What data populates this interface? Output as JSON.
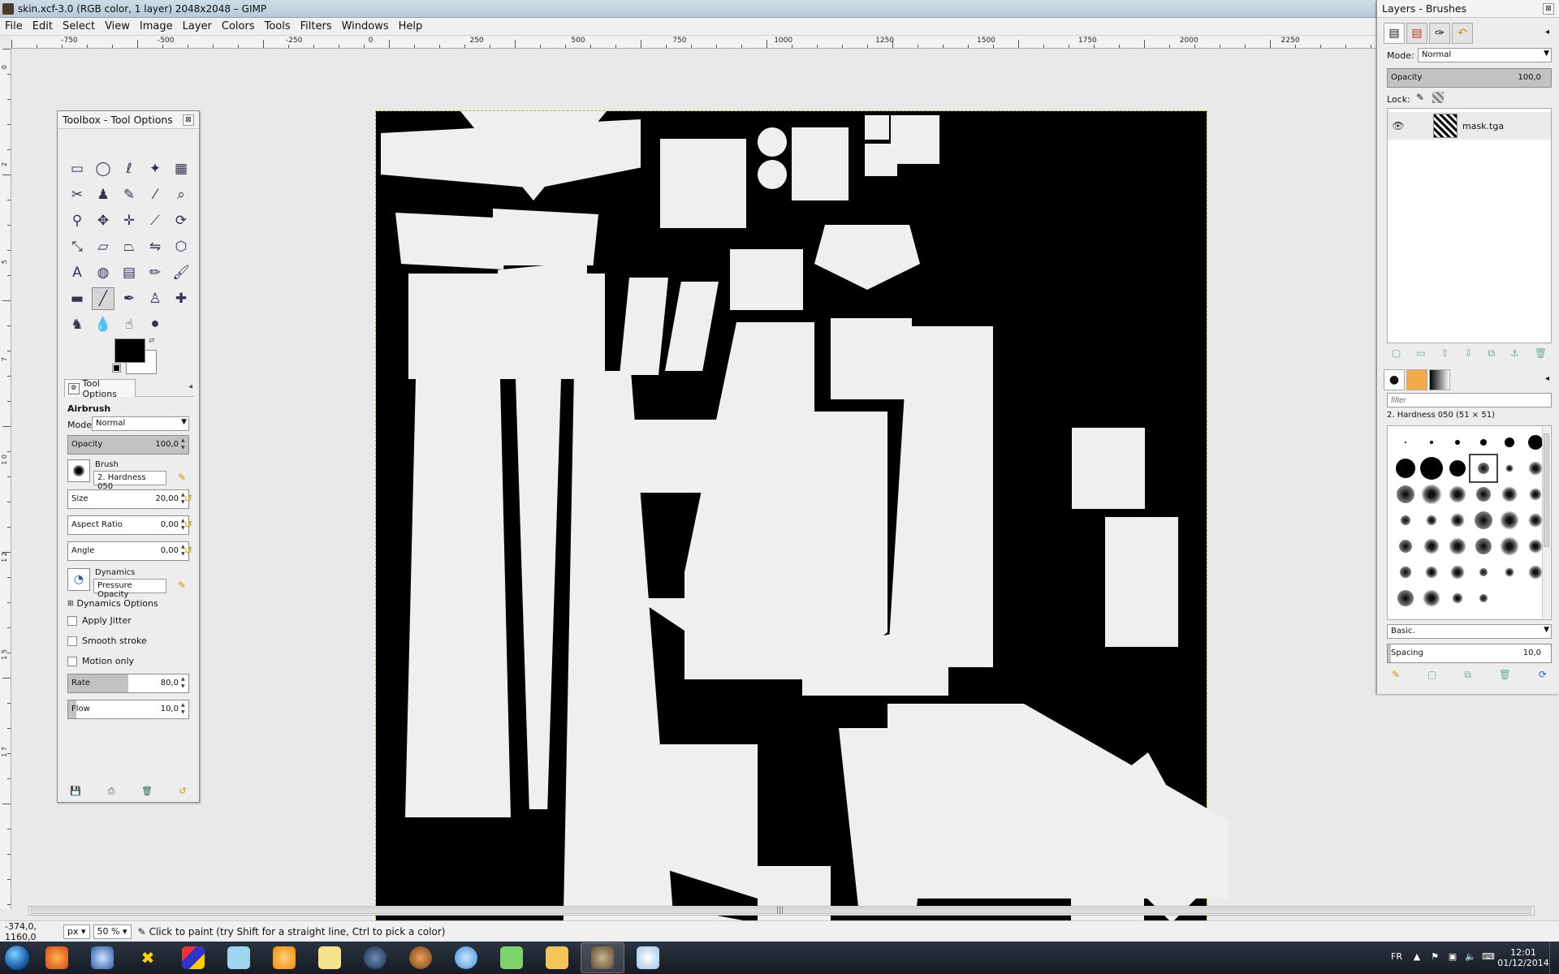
{
  "window": {
    "title": "skin.xcf-3.0 (RGB color, 1 layer) 2048x2048 – GIMP",
    "background_tab": ""
  },
  "menu": [
    "File",
    "Edit",
    "Select",
    "View",
    "Image",
    "Layer",
    "Colors",
    "Tools",
    "Filters",
    "Windows",
    "Help"
  ],
  "ruler": {
    "h_labels": [
      "-750",
      "-500",
      "-250",
      "0",
      "250",
      "500",
      "750",
      "1000",
      "1250",
      "1500",
      "1750",
      "2000",
      "2250"
    ],
    "v_labels": [
      "0",
      "2",
      "5",
      "7",
      "1 0",
      "1 2",
      "1 5",
      "1 7"
    ]
  },
  "toolbox": {
    "title": "Toolbox - Tool Options",
    "close": "⊠",
    "tools": [
      {
        "name": "rect-select-icon",
        "glyph": "▭"
      },
      {
        "name": "ellipse-select-icon",
        "glyph": "◯"
      },
      {
        "name": "free-select-icon",
        "glyph": "ℓ"
      },
      {
        "name": "fuzzy-select-icon",
        "glyph": "✦"
      },
      {
        "name": "select-by-color-icon",
        "glyph": "▦"
      },
      {
        "name": "scissors-icon",
        "glyph": "✂"
      },
      {
        "name": "foreground-select-icon",
        "glyph": "♟"
      },
      {
        "name": "paths-icon",
        "glyph": "✎"
      },
      {
        "name": "color-picker-icon",
        "glyph": "⁄"
      },
      {
        "name": "zoom-icon",
        "glyph": "⌕"
      },
      {
        "name": "measure-icon",
        "glyph": "⚲"
      },
      {
        "name": "move-icon",
        "glyph": "✥"
      },
      {
        "name": "align-icon",
        "glyph": "✛"
      },
      {
        "name": "crop-icon",
        "glyph": "⟋"
      },
      {
        "name": "rotate-icon",
        "glyph": "⟳"
      },
      {
        "name": "scale-icon",
        "glyph": "⤡"
      },
      {
        "name": "shear-icon",
        "glyph": "▱"
      },
      {
        "name": "perspective-icon",
        "glyph": "⏢"
      },
      {
        "name": "flip-icon",
        "glyph": "⇋"
      },
      {
        "name": "cage-icon",
        "glyph": "⬡"
      },
      {
        "name": "text-icon",
        "glyph": "A"
      },
      {
        "name": "bucket-fill-icon",
        "glyph": "◍"
      },
      {
        "name": "blend-icon",
        "glyph": "▤"
      },
      {
        "name": "pencil-icon",
        "glyph": "✏"
      },
      {
        "name": "paintbrush-icon",
        "glyph": "🖌"
      },
      {
        "name": "eraser-icon",
        "glyph": "▬"
      },
      {
        "name": "airbrush-icon",
        "glyph": "╱"
      },
      {
        "name": "ink-icon",
        "glyph": "✒"
      },
      {
        "name": "clone-icon",
        "glyph": "♙"
      },
      {
        "name": "heal-icon",
        "glyph": "✚"
      },
      {
        "name": "perspective-clone-icon",
        "glyph": "♞"
      },
      {
        "name": "blur-icon",
        "glyph": "💧"
      },
      {
        "name": "smudge-icon",
        "glyph": "☝"
      },
      {
        "name": "dodge-burn-icon",
        "glyph": "⚫"
      }
    ],
    "tab_label": "Tool Options",
    "tool_name": "Airbrush",
    "mode_label": "Mode:",
    "mode_value": "Normal",
    "opacity": {
      "label": "Opacity",
      "value": "100,0",
      "fraction": 1.0
    },
    "brush_label": "Brush",
    "brush_value": "2. Hardness 050",
    "size": {
      "label": "Size",
      "value": "20,00",
      "fraction": 0.0
    },
    "aspect": {
      "label": "Aspect Ratio",
      "value": "0,00",
      "fraction": 0.0
    },
    "angle": {
      "label": "Angle",
      "value": "0,00",
      "fraction": 0.0
    },
    "dynamics_label": "Dynamics",
    "dynamics_value": "Pressure Opacity",
    "dynamics_options": "Dynamics Options",
    "apply_jitter": "Apply Jitter",
    "smooth_stroke": "Smooth stroke",
    "motion_only": "Motion only",
    "rate": {
      "label": "Rate",
      "value": "80,0",
      "fraction": 0.5
    },
    "flow": {
      "label": "Flow",
      "value": "10,0",
      "fraction": 0.07
    }
  },
  "status": {
    "coords": "-374,0, 1160,0",
    "unit": "px",
    "zoom": "50 %",
    "message": "Click to paint (try Shift for a straight line, Ctrl to pick a color)"
  },
  "dock": {
    "title": "Layers - Brushes",
    "close": "⊠",
    "mode_label": "Mode:",
    "mode_value": "Normal",
    "opacity_label": "Opacity",
    "opacity_value": "100,0",
    "lock_label": "Lock:",
    "layer_name": "mask.tga",
    "brush_filter_placeholder": "filter",
    "brush_selected": "2. Hardness 050 (51 × 51)",
    "brush_tag": "Basic.",
    "spacing_label": "Spacing",
    "spacing_value": "10,0"
  },
  "tray": {
    "lang": "FR",
    "time": "12:01",
    "date": "01/12/2014"
  },
  "colors": {
    "accent": "#c79a00",
    "paper": "#efefef",
    "canvas": "#000000"
  }
}
